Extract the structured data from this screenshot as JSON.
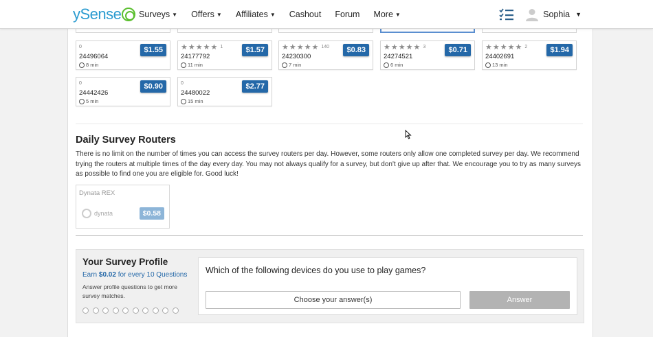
{
  "nav": {
    "logo_text": "ySense",
    "items": [
      {
        "label": "Surveys",
        "caret": true
      },
      {
        "label": "Offers",
        "caret": true
      },
      {
        "label": "Affiliates",
        "caret": true
      },
      {
        "label": "Cashout",
        "caret": false
      },
      {
        "label": "Forum",
        "caret": false
      },
      {
        "label": "More",
        "caret": true
      }
    ],
    "username": "Sophia"
  },
  "surveys": [
    {
      "rating": "0",
      "stars": "",
      "count": "",
      "id": "24496064",
      "duration": "8 min",
      "price": "$1.55"
    },
    {
      "rating": "",
      "stars": "★★★★★",
      "count": "1",
      "id": "24177792",
      "duration": "11 min",
      "price": "$1.57"
    },
    {
      "rating": "",
      "stars": "★★★★★",
      "count": "140",
      "id": "24230300",
      "duration": "7 min",
      "price": "$0.83"
    },
    {
      "rating": "",
      "stars": "★★★★★",
      "count": "3",
      "id": "24274521",
      "duration": "6 min",
      "price": "$0.71"
    },
    {
      "rating": "",
      "stars": "★★★★★",
      "count": "2",
      "id": "24402691",
      "duration": "13 min",
      "price": "$1.94"
    },
    {
      "rating": "0",
      "stars": "",
      "count": "",
      "id": "24442426",
      "duration": "5 min",
      "price": "$0.90"
    },
    {
      "rating": "0",
      "stars": "",
      "count": "",
      "id": "24480022",
      "duration": "15 min",
      "price": "$2.77"
    }
  ],
  "routers": {
    "title": "Daily Survey Routers",
    "description": "There is no limit on the number of times you can access the survey routers per day. However, some routers only allow one completed survey per day. We recommend trying the routers at multiple times of the day every day. You may not always qualify for a survey, but don't give up after that. We encourage you to try as many surveys as possible to find one you are eligible for. Good luck!",
    "items": [
      {
        "name": "Dynata REX",
        "brand": "dynata",
        "price": "$0.58"
      }
    ]
  },
  "profile": {
    "title": "Your Survey Profile",
    "earn_prefix": "Earn ",
    "earn_amount": "$0.02",
    "earn_suffix": " for every 10 Questions",
    "hint": "Answer profile questions to get more survey matches.",
    "question": "Which of the following devices do you use to play games?",
    "choose_label": "Choose your answer(s)",
    "answer_label": "Answer",
    "progress_total": 10,
    "progress_done": 0
  },
  "colors": {
    "price_badge": "#2468a8",
    "router_badge": "#8db5d8",
    "brand_blue": "#2b9bd0",
    "brand_green": "#5bbf2f"
  }
}
